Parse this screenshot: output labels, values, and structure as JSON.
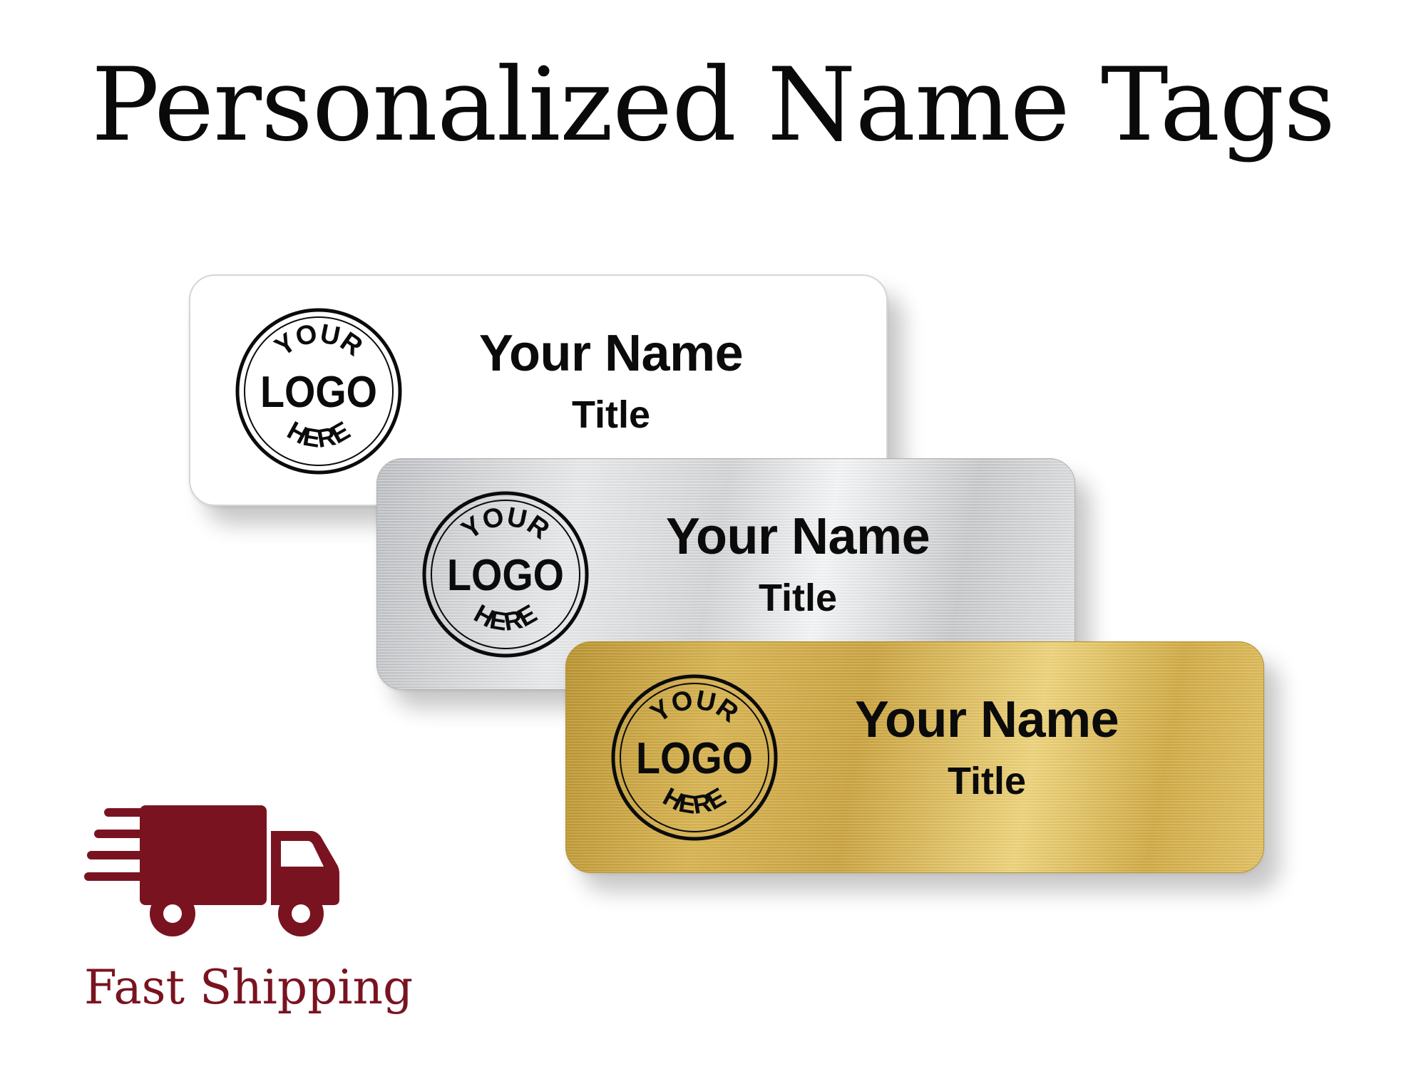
{
  "title": "Personalized Name Tags",
  "colors": {
    "accent": "#7a1320",
    "title_text": "#0a0a0a",
    "white_tag": "#ffffff",
    "silver_tag": "#d8d9db",
    "gold_tag": "#d6b24f"
  },
  "tags": [
    {
      "finish": "white",
      "logo": {
        "top": "YOUR",
        "middle": "LOGO",
        "bottom": "HERE"
      },
      "name": "Your Name",
      "title": "Title"
    },
    {
      "finish": "silver",
      "logo": {
        "top": "YOUR",
        "middle": "LOGO",
        "bottom": "HERE"
      },
      "name": "Your Name",
      "title": "Title"
    },
    {
      "finish": "gold",
      "logo": {
        "top": "YOUR",
        "middle": "LOGO",
        "bottom": "HERE"
      },
      "name": "Your Name",
      "title": "Title"
    }
  ],
  "shipping": {
    "icon": "delivery-truck-icon",
    "label": "Fast Shipping"
  }
}
